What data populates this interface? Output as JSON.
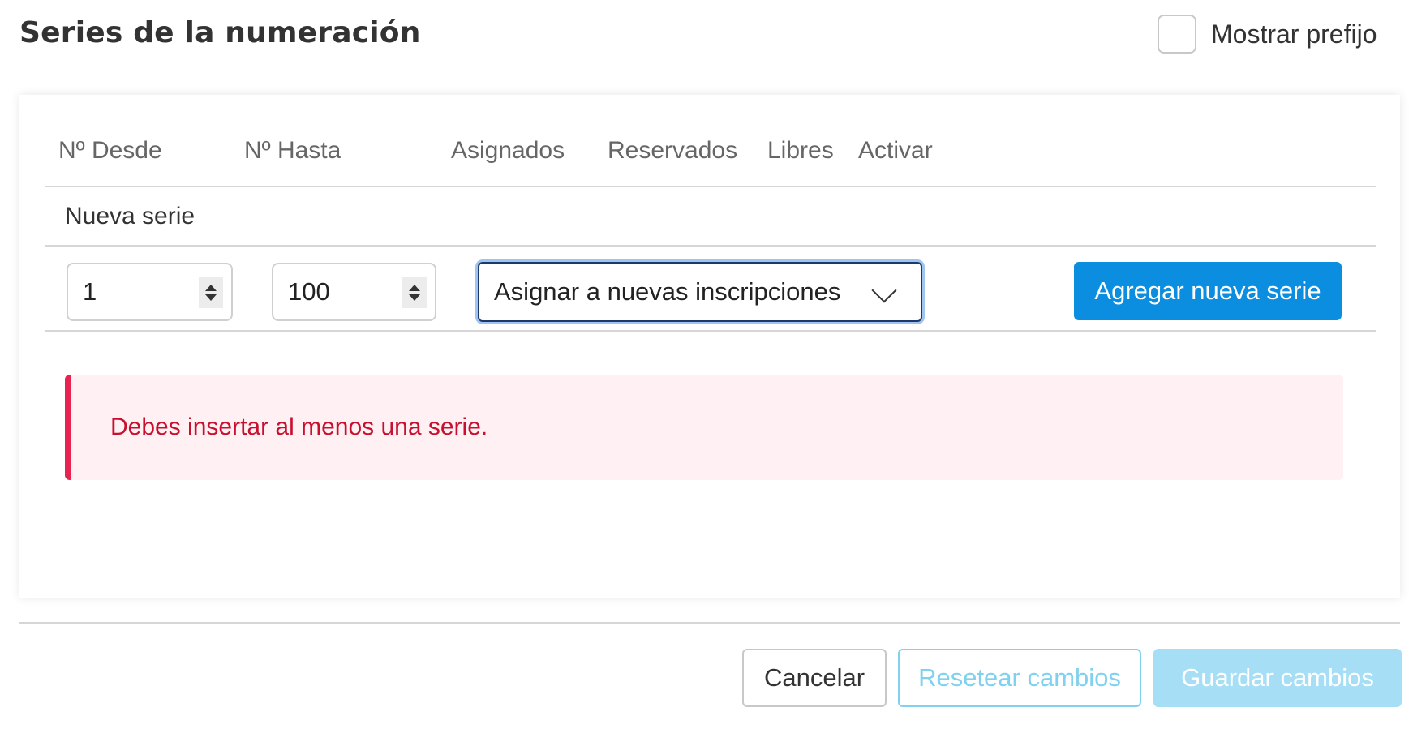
{
  "header": {
    "title": "Series de la numeración",
    "show_prefix_label": "Mostrar prefijo",
    "show_prefix_checked": false
  },
  "table": {
    "columns": [
      "Nº Desde",
      "Nº Hasta",
      "Asignados",
      "Reservados",
      "Libres",
      "Activar"
    ],
    "new_series_label": "Nueva serie",
    "from_value": "1",
    "to_value": "100",
    "assign_select_value": "Asignar a nuevas inscripciones",
    "add_button_label": "Agregar nueva serie"
  },
  "alert": {
    "message": "Debes insertar al menos una serie."
  },
  "footer": {
    "cancel_label": "Cancelar",
    "reset_label": "Resetear cambios",
    "save_label": "Guardar cambios"
  },
  "colors": {
    "primary": "#0c8ee0",
    "error_text": "#c8102e",
    "error_border": "#e8234f",
    "error_bg": "#fff0f3",
    "disabled_primary": "#a6dff5"
  }
}
